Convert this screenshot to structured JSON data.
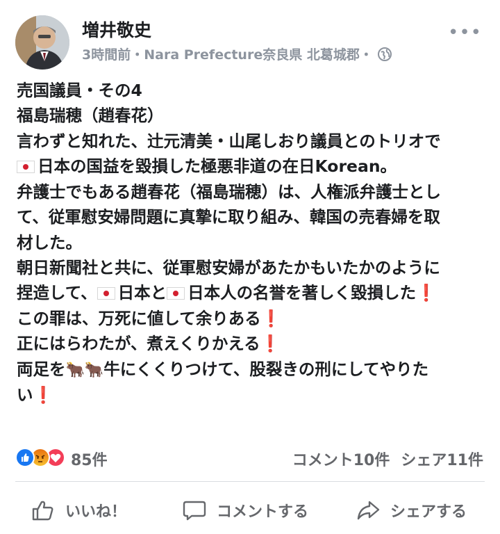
{
  "post": {
    "author": "増井敬史",
    "meta": "3時間前・Nara Prefecture奈良県 北葛城郡・",
    "more_label": "•••",
    "lines": {
      "l1": "売国議員・その4",
      "l2": "福島瑞穂（趙春花）",
      "l3": "言わずと知れた、辻元清美・山尾しおり議員とのトリオで",
      "l4": "日本の国益を毀損した極悪非道の在日Korean。",
      "l5": "弁護士でもある趙春花（福島瑞穂）は、人権派弁護士とし",
      "l6": "て、従軍慰安婦問題に真摯に取り組み、韓国の売春婦を取",
      "l7": "材した。",
      "l8": "朝日新聞社と共に、従軍慰安婦があたかもいたかのように",
      "l9a": "捏造して、",
      "l9b": "日本と",
      "l9c": "日本人の名誉を著しく毀損した",
      "l10": "この罪は、万死に値して余りある",
      "l11": "正にはらわたが、煮えくりかえる",
      "l12a": "両足を",
      "l12b": "牛にくくりつけて、股裂きの刑にしてやりた",
      "l13": "い",
      "exclaim": "❗",
      "ox_emoji": "🐂🐂"
    }
  },
  "reactions": {
    "count": "85件",
    "types": [
      "like",
      "angry",
      "love"
    ],
    "colors": {
      "like": "#1877f2",
      "angry": "#f0901f",
      "love": "#f33e58"
    }
  },
  "stats": {
    "comments": "コメント10件",
    "shares": "シェア11件"
  },
  "actions": {
    "like": "いいね！",
    "comment": "コメントする",
    "share": "シェアする"
  }
}
